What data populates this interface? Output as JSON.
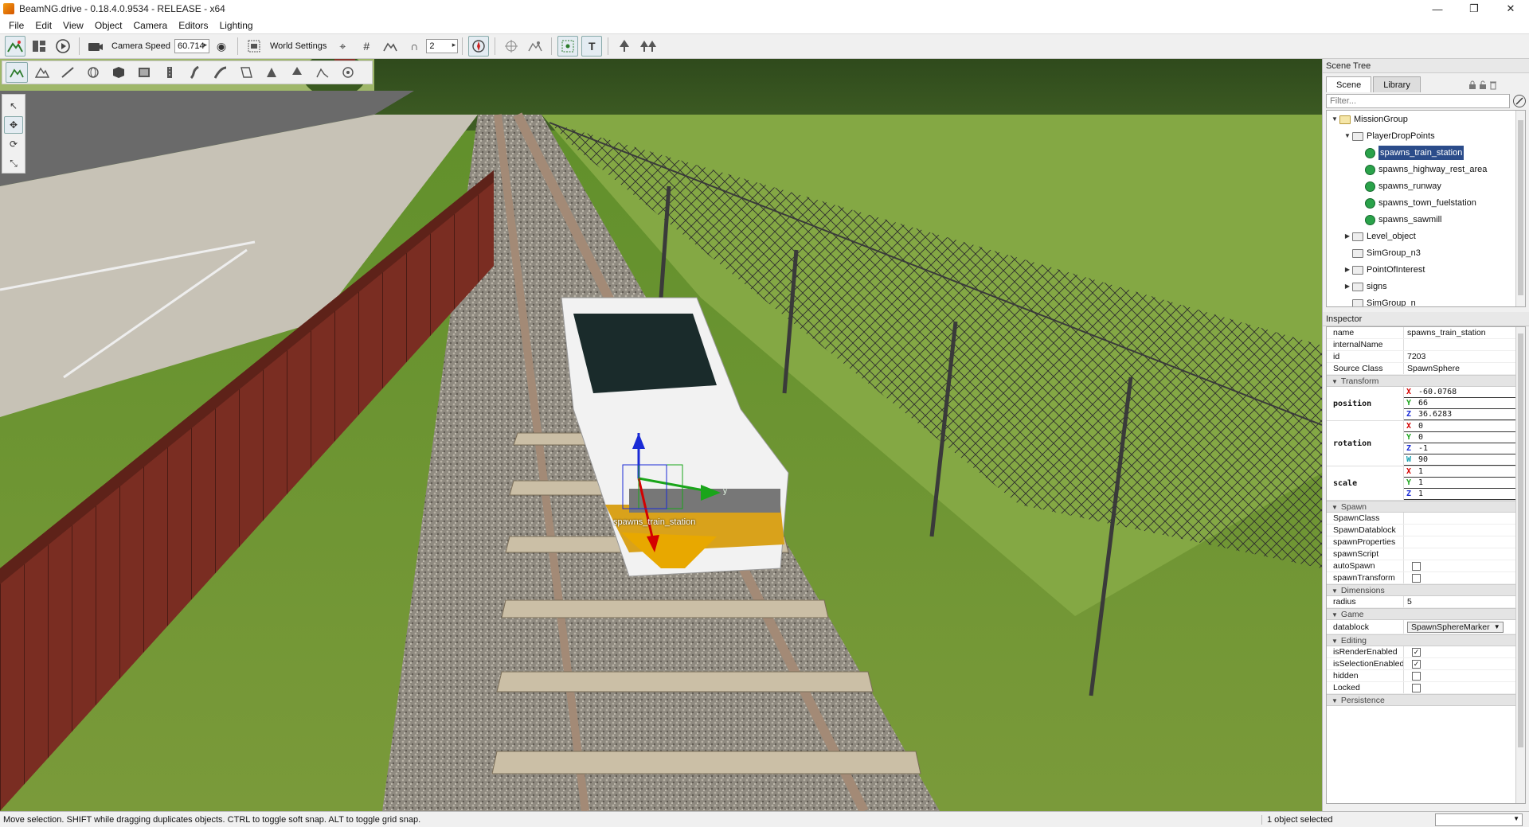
{
  "window": {
    "title": "BeamNG.drive - 0.18.4.0.9534 - RELEASE - x64",
    "minimize": "—",
    "maximize": "❐",
    "close": "✕"
  },
  "menu": [
    "File",
    "Edit",
    "View",
    "Object",
    "Camera",
    "Editors",
    "Lighting"
  ],
  "toolbar": {
    "camera_speed_label": "Camera Speed",
    "camera_speed_value": "60.714",
    "world_settings_label": "World Settings",
    "grid_value": "2"
  },
  "viewport": {
    "object_label": "spawns_train_station",
    "gizmo_axis_y": "y"
  },
  "scene_tree": {
    "title": "Scene Tree",
    "tabs": [
      "Scene",
      "Library"
    ],
    "filter_placeholder": "Filter...",
    "items": [
      {
        "label": "MissionGroup",
        "depth": 0,
        "kind": "folder-open",
        "expander": "▼"
      },
      {
        "label": "PlayerDropPoints",
        "depth": 1,
        "kind": "folder",
        "expander": "▼"
      },
      {
        "label": "spawns_train_station",
        "depth": 2,
        "kind": "spawn",
        "expander": "",
        "selected": true
      },
      {
        "label": "spawns_highway_rest_area",
        "depth": 2,
        "kind": "spawn",
        "expander": ""
      },
      {
        "label": "spawns_runway",
        "depth": 2,
        "kind": "spawn",
        "expander": ""
      },
      {
        "label": "spawns_town_fuelstation",
        "depth": 2,
        "kind": "spawn",
        "expander": ""
      },
      {
        "label": "spawns_sawmill",
        "depth": 2,
        "kind": "spawn",
        "expander": ""
      },
      {
        "label": "Level_object",
        "depth": 1,
        "kind": "folder",
        "expander": "▶"
      },
      {
        "label": "SimGroup_n3",
        "depth": 1,
        "kind": "folder",
        "expander": ""
      },
      {
        "label": "PointOfInterest",
        "depth": 1,
        "kind": "folder",
        "expander": "▶"
      },
      {
        "label": "signs",
        "depth": 1,
        "kind": "folder",
        "expander": "▶"
      },
      {
        "label": "SimGroup_n",
        "depth": 1,
        "kind": "folder",
        "expander": ""
      }
    ]
  },
  "inspector": {
    "title": "Inspector",
    "general": [
      {
        "key": "name",
        "value": "spawns_train_station"
      },
      {
        "key": "internalName",
        "value": ""
      },
      {
        "key": "id",
        "value": "7203"
      },
      {
        "key": "Source Class",
        "value": "SpawnSphere"
      }
    ],
    "transform_section": "Transform",
    "position": {
      "label": "position",
      "x": "-60.0768",
      "y": "66",
      "z": "36.6283"
    },
    "rotation": {
      "label": "rotation",
      "x": "0",
      "y": "0",
      "z": "-1",
      "w": "90"
    },
    "scale": {
      "label": "scale",
      "x": "1",
      "y": "1",
      "z": "1"
    },
    "spawn_section": "Spawn",
    "spawn": [
      {
        "key": "SpawnClass",
        "value": ""
      },
      {
        "key": "SpawnDatablock",
        "value": ""
      },
      {
        "key": "spawnProperties",
        "value": ""
      },
      {
        "key": "spawnScript",
        "value": ""
      }
    ],
    "auto_spawn_label": "autoSpawn",
    "spawn_transform_label": "spawnTransform",
    "dimensions_section": "Dimensions",
    "radius": {
      "key": "radius",
      "value": "5"
    },
    "game_section": "Game",
    "datablock": {
      "key": "datablock",
      "value": "SpawnSphereMarker"
    },
    "editing_section": "Editing",
    "render_enabled_label": "isRenderEnabled",
    "selection_enabled_label": "isSelectionEnabled",
    "hidden_label": "hidden",
    "locked_label": "Locked",
    "persistence_section": "Persistence",
    "check_mark": "✓"
  },
  "status": {
    "message": "Move selection.  SHIFT while dragging duplicates objects.  CTRL to toggle soft snap.  ALT to toggle grid snap.",
    "selection": "1 object selected"
  },
  "colors": {
    "selection": "#2b4c8a",
    "spawn_icon": "#2aa24a",
    "axis_x": "#d40000",
    "axis_y": "#1aa51a",
    "axis_z": "#1a2bd6"
  },
  "icons": {
    "arrow": "▸",
    "eye": "◉",
    "snap": "⌖",
    "grid": "#",
    "magnet": "∩",
    "compass": "◎",
    "text": "T",
    "select": "↖",
    "move": "✥",
    "rotate": "⟳",
    "scale": "⤡"
  }
}
